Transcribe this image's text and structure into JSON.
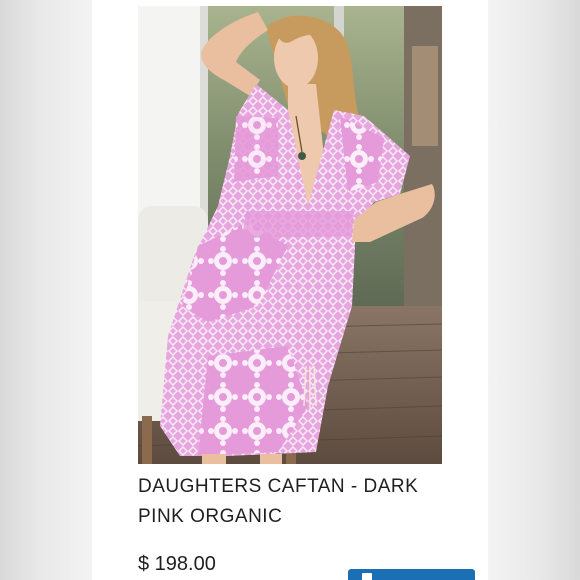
{
  "product": {
    "title": "DAUGHTERS CAFTAN - DARK PINK ORGANIC",
    "price": "$ 198.00"
  },
  "colors": {
    "caftan_pink": "#e7a6df",
    "pattern_white": "#fbeefa",
    "button_blue": "#1a6fb5",
    "deck_brown": "#6e5a4a"
  },
  "icons": {
    "cart_button_icon": "cart-icon"
  }
}
